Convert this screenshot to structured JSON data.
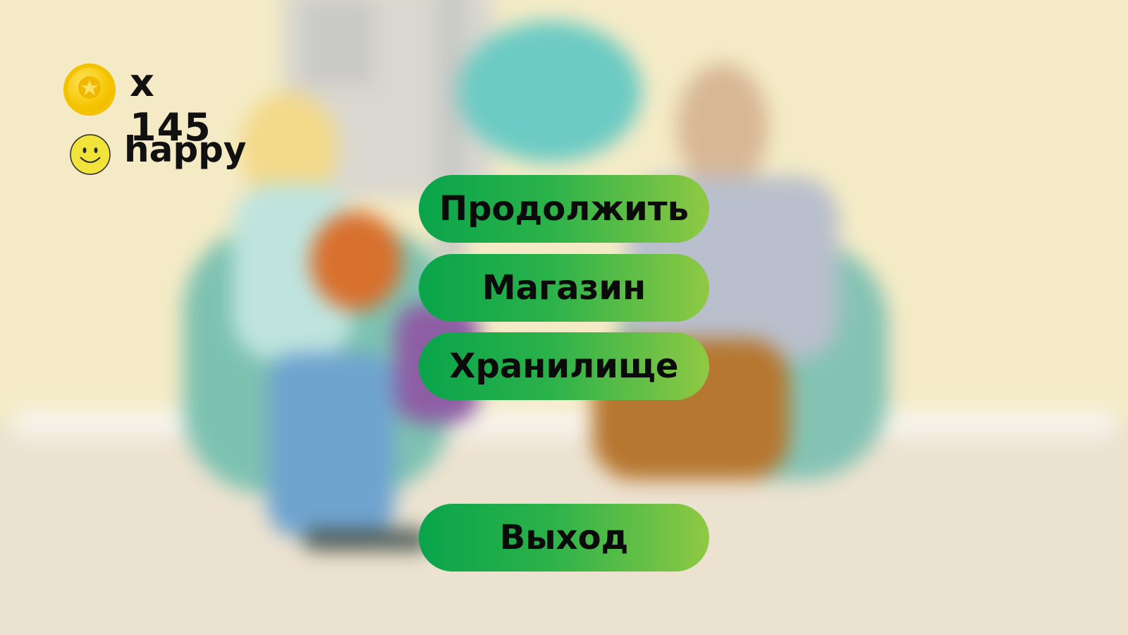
{
  "hud": {
    "coin_icon": "coin-star-icon",
    "coin_count": "x 145",
    "mood_icon": "smiley-icon",
    "mood_label": "happy"
  },
  "menu": {
    "continue_label": "Продолжить",
    "shop_label": "Магазин",
    "storage_label": "Хранилище",
    "exit_label": "Выход"
  },
  "colors": {
    "button_gradient_start": "#0aa44b",
    "button_gradient_end": "#8fc943",
    "coin": "#f6c400",
    "smiley": "#f2e33a",
    "background": "#f3e9c8"
  }
}
